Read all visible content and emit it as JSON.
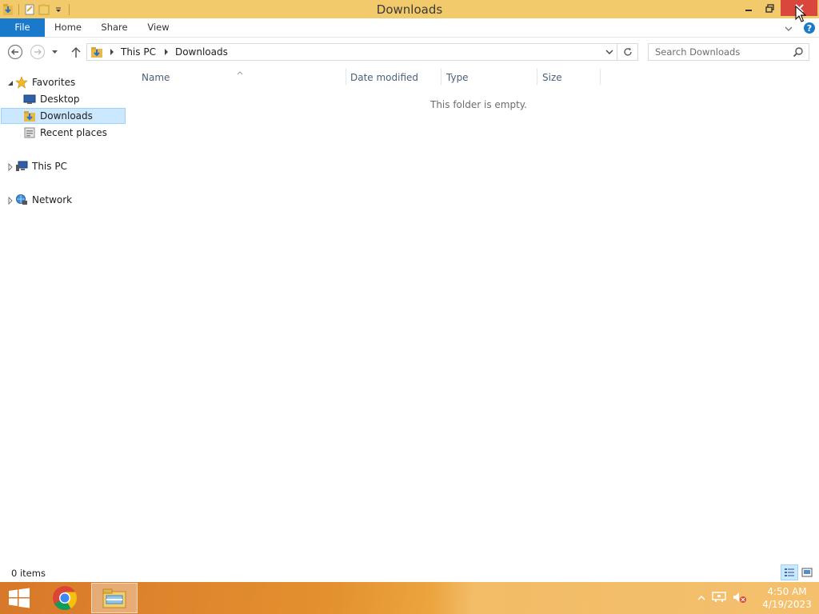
{
  "window": {
    "title": "Downloads"
  },
  "ribbon": {
    "tabs": [
      "File",
      "Home",
      "Share",
      "View"
    ]
  },
  "address": {
    "path": [
      "This PC",
      "Downloads"
    ]
  },
  "search": {
    "placeholder": "Search Downloads"
  },
  "navigation": {
    "favorites_label": "Favorites",
    "favorites_items": [
      "Desktop",
      "Downloads",
      "Recent places"
    ],
    "this_pc_label": "This PC",
    "network_label": "Network",
    "selected_item": "Downloads"
  },
  "content": {
    "columns": [
      "Name",
      "Date modified",
      "Type",
      "Size"
    ],
    "empty_message": "This folder is empty."
  },
  "status": {
    "item_count": "0 items"
  },
  "taskbar": {
    "apps": [
      "start-icon",
      "chrome-icon",
      "file-explorer-icon"
    ],
    "time": "4:50 AM",
    "date": "4/19/2023"
  },
  "colors": {
    "titlebar": "#f2c96b",
    "file_tab": "#1979ca",
    "close_button": "#d9463c",
    "selection": "#cce8ff",
    "taskbar": "#e3902f"
  }
}
